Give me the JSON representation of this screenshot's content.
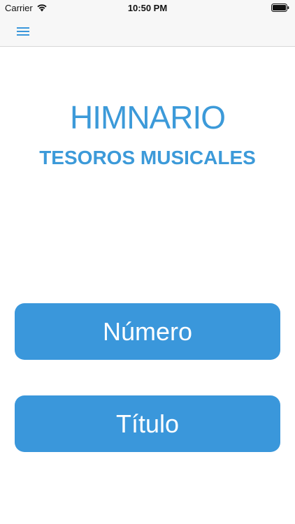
{
  "status_bar": {
    "carrier": "Carrier",
    "time": "10:50 PM",
    "wifi_icon": "wifi-icon",
    "battery_icon": "battery-icon"
  },
  "nav": {
    "menu_icon": "hamburger-menu-icon"
  },
  "hero": {
    "title": "HIMNARIO",
    "subtitle": "TESOROS MUSICALES"
  },
  "buttons": {
    "numero_label": "Número",
    "titulo_label": "Título"
  },
  "colors": {
    "accent": "#3a97db",
    "button_text": "#ffffff",
    "bar_bg": "#f7f7f7"
  }
}
